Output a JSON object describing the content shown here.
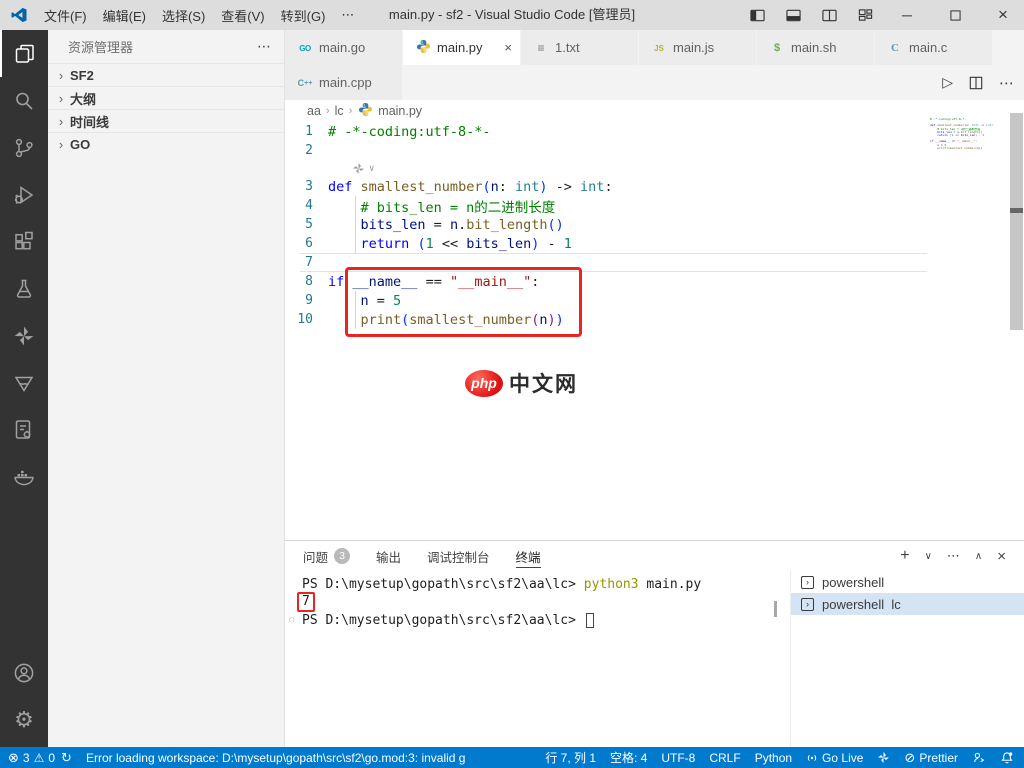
{
  "titlebar": {
    "menus": [
      "文件(F)",
      "编辑(E)",
      "选择(S)",
      "查看(V)",
      "转到(G)",
      "⋯"
    ],
    "title": "main.py - sf2 - Visual Studio Code [管理员]"
  },
  "sidebar": {
    "header": "资源管理器",
    "more": "⋯",
    "sections": [
      {
        "name": "sf2",
        "label": "SF2"
      },
      {
        "name": "outline",
        "label": "大纲"
      },
      {
        "name": "timeline",
        "label": "时间线"
      },
      {
        "name": "go",
        "label": "GO"
      }
    ]
  },
  "tabs_row1": [
    {
      "name": "main-go",
      "label": "main.go",
      "icon": "go"
    },
    {
      "name": "main-py",
      "label": "main.py",
      "icon": "python",
      "active": true
    },
    {
      "name": "1-txt",
      "label": "1.txt",
      "icon": "txt"
    },
    {
      "name": "main-js",
      "label": "main.js",
      "icon": "js"
    },
    {
      "name": "main-sh",
      "label": "main.sh",
      "icon": "sh"
    },
    {
      "name": "main-c",
      "label": "main.c",
      "icon": "c"
    }
  ],
  "tabs_row2": [
    {
      "name": "main-cpp",
      "label": "main.cpp",
      "icon": "cpp"
    }
  ],
  "breadcrumb": {
    "items": [
      "aa",
      "lc"
    ],
    "file": "main.py"
  },
  "code": {
    "lines": [
      {
        "n": "1",
        "indent": 0,
        "tokens": [
          [
            "cm",
            "# -*-coding:utf-8-*-"
          ]
        ]
      },
      {
        "n": "2",
        "indent": 0,
        "tokens": []
      },
      {
        "n": "",
        "lens": true,
        "tokens": []
      },
      {
        "n": "3",
        "indent": 0,
        "tokens": [
          [
            "kw",
            "def"
          ],
          [
            "pl",
            " "
          ],
          [
            "fn",
            "smallest_number"
          ],
          [
            "p1",
            "("
          ],
          [
            "var",
            "n"
          ],
          [
            "pl",
            ": "
          ],
          [
            "ty",
            "int"
          ],
          [
            "p1",
            ")"
          ],
          [
            "pl",
            " -> "
          ],
          [
            "ty",
            "int"
          ],
          [
            "pl",
            ":"
          ]
        ]
      },
      {
        "n": "4",
        "indent": 1,
        "guide": true,
        "tokens": [
          [
            "cm",
            "# bits_len = n的二进制长度"
          ]
        ]
      },
      {
        "n": "5",
        "indent": 1,
        "guide": true,
        "tokens": [
          [
            "var",
            "bits_len"
          ],
          [
            "pl",
            " = "
          ],
          [
            "var",
            "n"
          ],
          [
            "pl",
            "."
          ],
          [
            "fn",
            "bit_length"
          ],
          [
            "p1",
            "()"
          ]
        ]
      },
      {
        "n": "6",
        "indent": 1,
        "guide": true,
        "tokens": [
          [
            "kw",
            "return"
          ],
          [
            "pl",
            " "
          ],
          [
            "p1",
            "("
          ],
          [
            "num",
            "1"
          ],
          [
            "pl",
            " << "
          ],
          [
            "var",
            "bits_len"
          ],
          [
            "p1",
            ")"
          ],
          [
            "pl",
            " - "
          ],
          [
            "num",
            "1"
          ]
        ]
      },
      {
        "n": "7",
        "indent": 0,
        "current": true,
        "tokens": []
      },
      {
        "n": "8",
        "indent": 0,
        "tokens": [
          [
            "kw",
            "if"
          ],
          [
            "pl",
            " "
          ],
          [
            "var",
            "__name__"
          ],
          [
            "pl",
            " == "
          ],
          [
            "str",
            "\"__main__\""
          ],
          [
            "pl",
            ":"
          ]
        ]
      },
      {
        "n": "9",
        "indent": 1,
        "guide": true,
        "tokens": [
          [
            "var",
            "n"
          ],
          [
            "pl",
            " = "
          ],
          [
            "num",
            "5"
          ]
        ]
      },
      {
        "n": "10",
        "indent": 1,
        "guide": true,
        "tokens": [
          [
            "fn",
            "print"
          ],
          [
            "p1",
            "("
          ],
          [
            "fn",
            "smallest_number"
          ],
          [
            "p2",
            "("
          ],
          [
            "var",
            "n"
          ],
          [
            "p2",
            ")"
          ],
          [
            "p1",
            ")"
          ]
        ]
      }
    ]
  },
  "watermark": {
    "badge": "php",
    "text": "中文网"
  },
  "panel": {
    "tabs": [
      {
        "name": "problems",
        "label": "问题",
        "badge": "3"
      },
      {
        "name": "output",
        "label": "输出"
      },
      {
        "name": "debug-console",
        "label": "调试控制台"
      },
      {
        "name": "terminal",
        "label": "终端",
        "active": true
      }
    ],
    "terminal_lines": [
      {
        "tokens": [
          [
            "pl",
            "PS D:\\mysetup\\gopath\\src\\sf2\\aa\\lc> "
          ],
          [
            "cmd",
            "python3"
          ],
          [
            "pl",
            " main.py"
          ]
        ]
      },
      {
        "tokens": [
          [
            "boxed",
            "7"
          ]
        ]
      },
      {
        "deco": true,
        "cursor": true,
        "tokens": [
          [
            "pl",
            "PS D:\\mysetup\\gopath\\src\\sf2\\aa\\lc> "
          ]
        ]
      }
    ],
    "terminal_list": [
      {
        "name": "powershell",
        "label": "powershell"
      },
      {
        "name": "powershell-lc",
        "label": "powershell  lc",
        "active": true
      }
    ]
  },
  "statusbar": {
    "errors": "3",
    "warnings": "0",
    "message": "Error loading workspace: D:\\mysetup\\gopath\\src\\sf2\\go.mod:3: invalid g",
    "line_col": "行 7, 列 1",
    "spaces": "空格: 4",
    "encoding": "UTF-8",
    "eol": "CRLF",
    "lang": "Python",
    "golive": "Go Live",
    "prettier": "Prettier"
  },
  "icons": {
    "chevron_right": "›",
    "chevron_down": "∨",
    "chevron_up": "∧",
    "close": "×",
    "plus": "+",
    "more_h": "⋯",
    "run": "▷",
    "minimize": "─",
    "error": "⊗",
    "warning": "⚠",
    "sync": "↻",
    "prettier_slash": "⊘",
    "deco_circle": "○"
  }
}
